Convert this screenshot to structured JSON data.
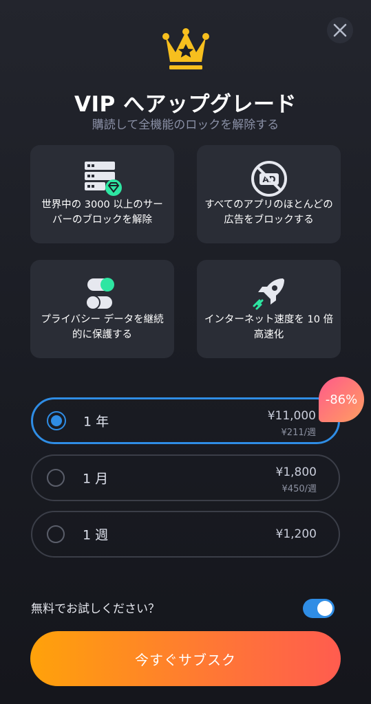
{
  "header": {
    "title": "VIP へアップグレード",
    "subtitle": "購読して全機能のロックを解除する"
  },
  "features": [
    {
      "icon": "server-gem-icon",
      "text": "世界中の 3000 以上のサーバーのブロックを解除"
    },
    {
      "icon": "no-ads-icon",
      "text": "すべてのアプリのほとんどの広告をブロックする",
      "icon_label": "AD"
    },
    {
      "icon": "privacy-toggle-icon",
      "text": "プライバシー データを継続的に保護する"
    },
    {
      "icon": "rocket-icon",
      "text": "インターネット速度を 10 倍高速化"
    }
  ],
  "plans": [
    {
      "name": "1 年",
      "price": "¥11,000",
      "per": "¥211/週",
      "selected": true
    },
    {
      "name": "1 月",
      "price": "¥1,800",
      "per": "¥450/週",
      "selected": false
    },
    {
      "name": "1 週",
      "price": "¥1,200",
      "selected": false
    }
  ],
  "discount_badge": "-86%",
  "trial": {
    "label": "無料でお試しください？",
    "enabled": true
  },
  "cta_label": "今すぐサブスク",
  "colors": {
    "accent_blue": "#2f8de5",
    "gold": "#f7bf1e",
    "green": "#2ee6a2",
    "cta_start": "#ffa20a",
    "cta_end": "#ff5c4f"
  }
}
